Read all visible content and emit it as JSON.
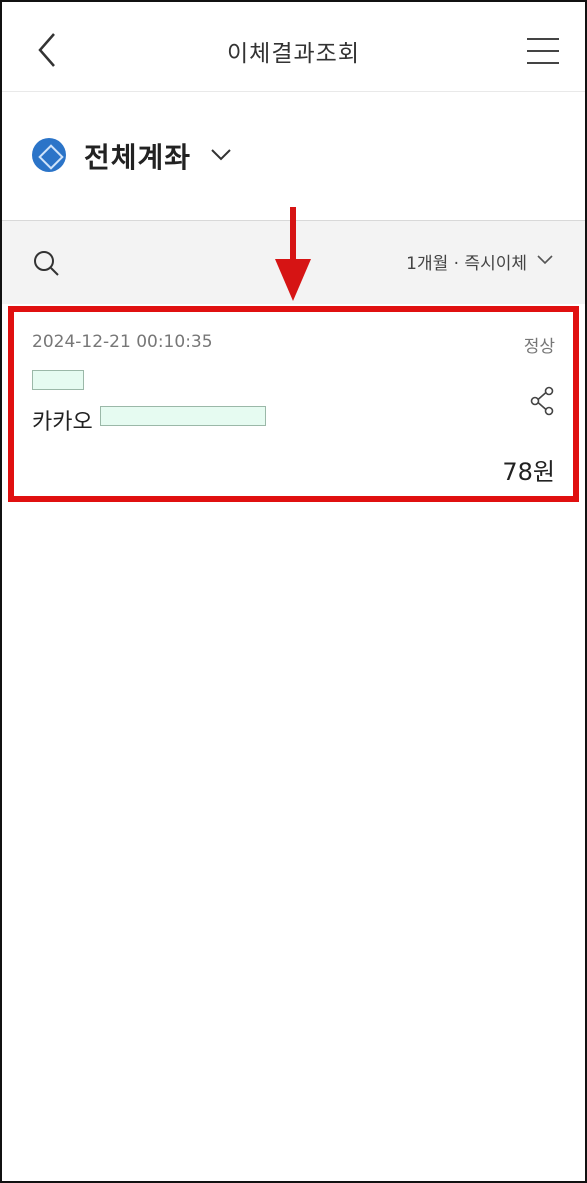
{
  "header": {
    "title": "이체결과조회",
    "back_icon": "chevron-left-icon",
    "menu_icon": "hamburger-menu-icon"
  },
  "account": {
    "name": "전체계좌",
    "logo_icon": "bank-logo-icon",
    "dropdown_icon": "chevron-down-icon"
  },
  "filter": {
    "search_icon": "search-icon",
    "summary": "1개월 · 즉시이체",
    "dropdown_icon": "chevron-down-icon"
  },
  "transactions": [
    {
      "datetime": "2024-12-21 00:10:35",
      "status": "정상",
      "bank": "카카오",
      "amount": "78원",
      "share_icon": "share-icon"
    }
  ],
  "colors": {
    "highlight_border": "#e01010",
    "filter_bg": "#f3f3f3",
    "mask_fill": "#e6fbf1"
  }
}
